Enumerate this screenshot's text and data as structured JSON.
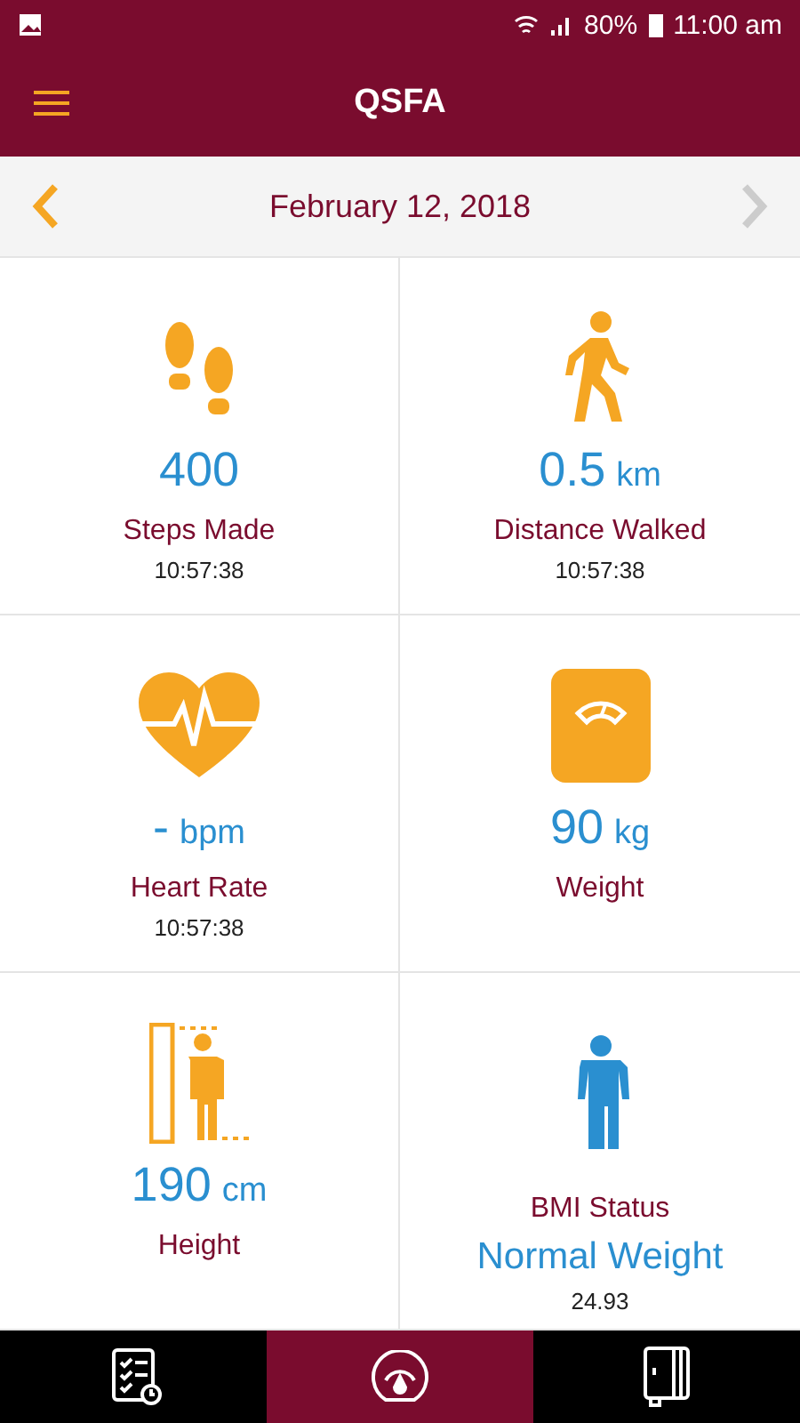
{
  "status_bar": {
    "battery": "80%",
    "time": "11:00 am"
  },
  "app_bar": {
    "title": "QSFA"
  },
  "date_bar": {
    "date": "February 12, 2018",
    "prev_disabled": false,
    "next_disabled": true
  },
  "tiles": [
    {
      "kind": "metric",
      "value": "400",
      "label": "Steps Made",
      "time": "10:57:38"
    },
    {
      "kind": "metric",
      "value": "0.5",
      "unit": "km",
      "label": "Distance Walked",
      "time": "10:57:38"
    },
    {
      "kind": "metric",
      "value": "-",
      "unit": "bpm",
      "label": "Heart Rate",
      "time": "10:57:38"
    },
    {
      "kind": "metric",
      "value": "90",
      "unit": "kg",
      "label": "Weight"
    },
    {
      "kind": "metric",
      "value": "190",
      "unit": "cm",
      "label": "Height"
    },
    {
      "kind": "status",
      "label": "BMI Status",
      "value": "Normal Weight",
      "time": "24.93"
    }
  ],
  "bottom_nav": [
    {
      "selected": false
    },
    {
      "selected": true
    },
    {
      "selected": false
    }
  ]
}
